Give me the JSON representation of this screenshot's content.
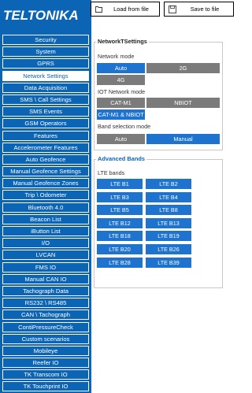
{
  "brand": {
    "logo_text": "TELTONIKA"
  },
  "toolbar": {
    "load_label": "Load from file",
    "save_label": "Save to file",
    "load_icon": "folder-open-icon",
    "save_icon": "save-icon"
  },
  "sidebar": {
    "active_item": "Network Settings",
    "items": [
      "Security",
      "System",
      "GPRS",
      "Network Settings",
      "Data Acquisition",
      "SMS \\ Call Settings",
      "SMS Events",
      "GSM Operators",
      "Features",
      "Accelerometer Features",
      "Auto Geofence",
      "Manual Geofence Settings",
      "Manual Geofence Zones",
      "Trip \\ Odometer",
      "Bluetooth 4.0",
      "Beacon List",
      "iButton List",
      "I/O",
      "LVCAN",
      "FMS IO",
      "Manual CAN IO",
      "Tachograph Data",
      "RS232 \\ RS485",
      "CAN \\ Tachograph",
      "ContiPressureCheck",
      "Custom scenarios",
      "Mobileye",
      "Reefer IO",
      "TK Transcom IO",
      "TK Touchprint IO"
    ]
  },
  "network": {
    "title": "NetworkTSettings",
    "network_mode": {
      "label": "Network mode",
      "options": [
        "Auto",
        "2G",
        "4G"
      ],
      "selected": "Auto"
    },
    "iot_mode": {
      "label": "IOT Network mode",
      "options": [
        "CAT-M1",
        "NBIOT",
        "CAT-M1 & NBIOT"
      ],
      "selected": "CAT-M1 & NBIOT"
    },
    "band_mode": {
      "label": "Band selection mode",
      "options": [
        "Auto",
        "Manual"
      ],
      "selected": "Manual"
    }
  },
  "bands": {
    "title": "Advanced Bands",
    "label": "LTE bands",
    "items": [
      "LTE B1",
      "LTE B2",
      "LTE B3",
      "LTE B4",
      "LTE B5",
      "LTE B8",
      "LTE B12",
      "LTE B13",
      "LTE B18",
      "LTE B19",
      "LTE B20",
      "LTE B26",
      "LTE B28",
      "LTE B39"
    ]
  },
  "colors": {
    "brand_blue": "#0c64b4",
    "selected_blue": "#1d73cd",
    "unselected_gray": "#7b7b7b"
  }
}
